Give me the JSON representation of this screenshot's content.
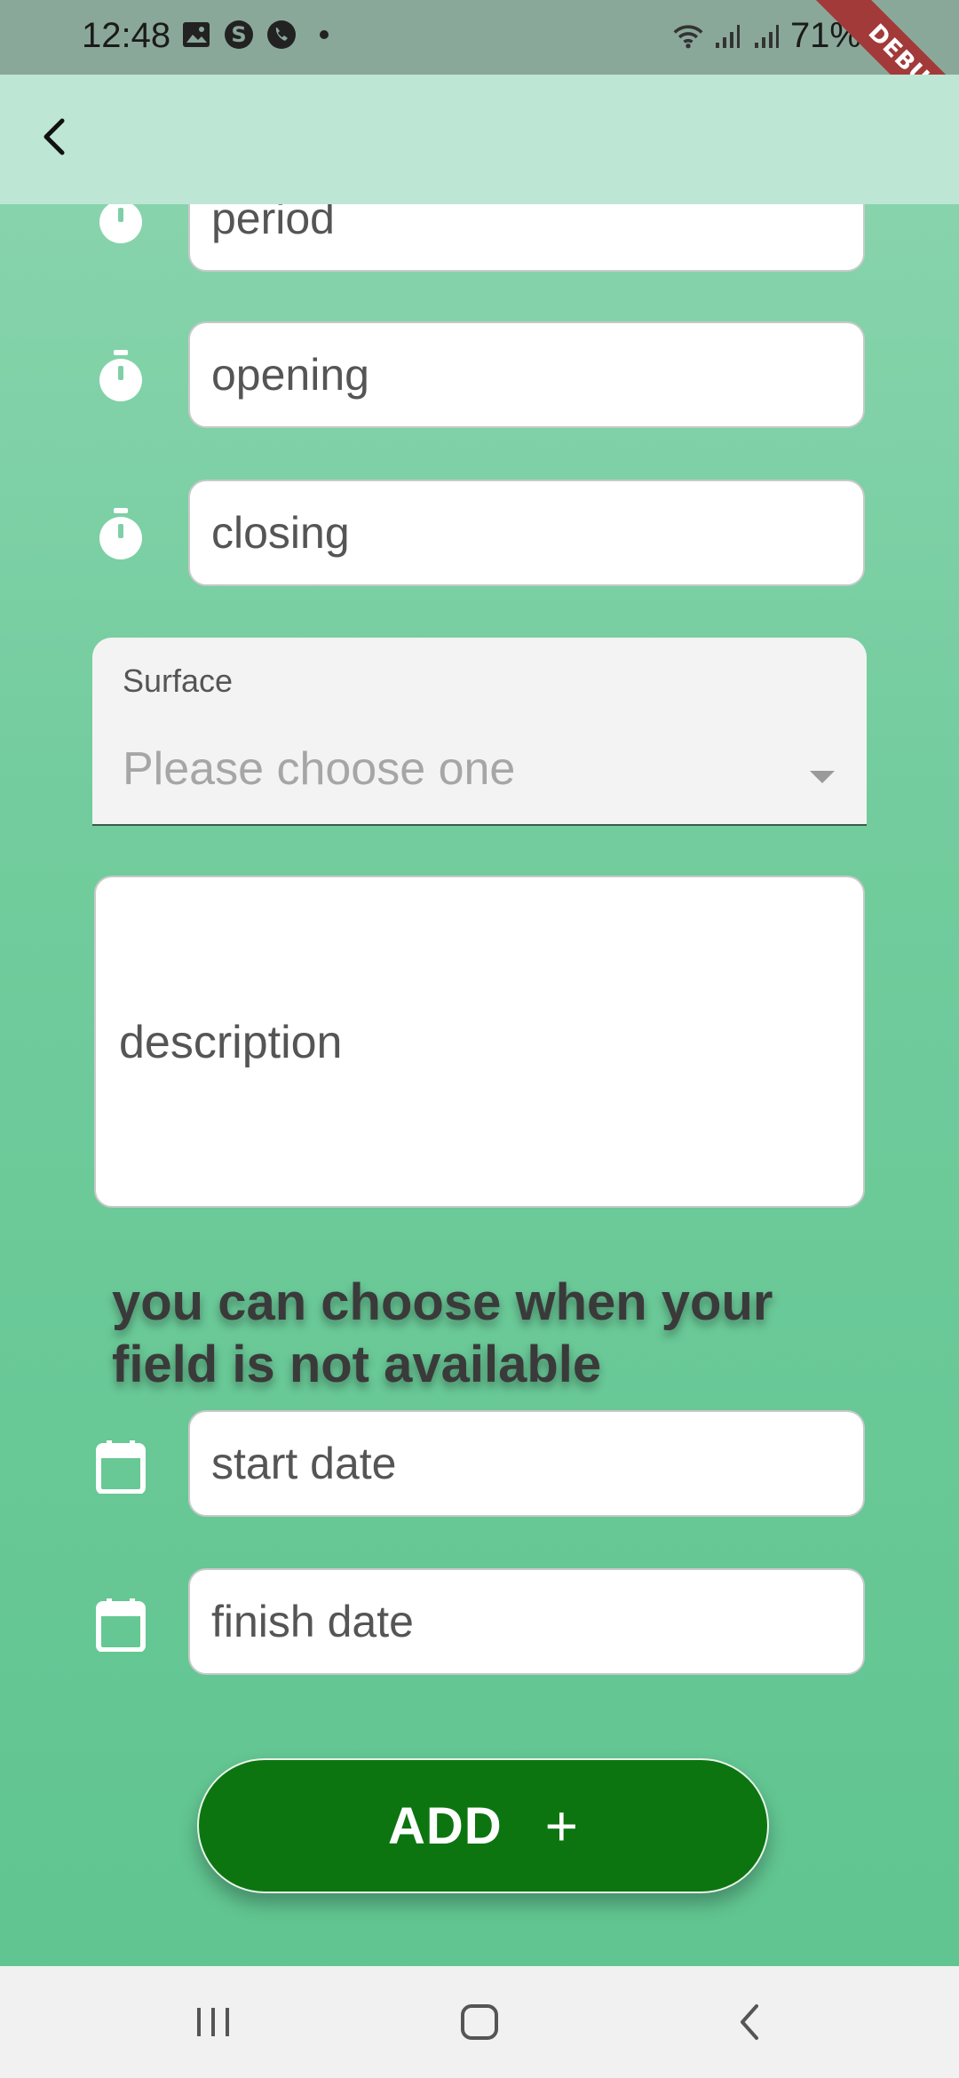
{
  "status_bar": {
    "time": "12:48",
    "battery_percent": "71%",
    "left_icons": [
      "image-icon",
      "s-badge-icon",
      "phone-icon",
      "dot-icon"
    ],
    "right_icons": [
      "wifi-icon",
      "signal-icon",
      "signal-icon",
      "battery-charging-icon"
    ]
  },
  "debug_ribbon": "DEBUG",
  "app_bar": {
    "back_icon": "chevron-left-icon"
  },
  "form": {
    "period_placeholder": "period",
    "opening_placeholder": "opening",
    "closing_placeholder": "closing",
    "surface": {
      "label": "Surface",
      "value_placeholder": "Please choose one"
    },
    "description_placeholder": "description",
    "notice": "you can choose when your field is not available",
    "start_date_placeholder": "start date",
    "finish_date_placeholder": "finish date",
    "add_button": {
      "label": "ADD",
      "icon": "+"
    }
  },
  "icons": {
    "timer": "timer-icon",
    "calendar": "calendar-icon"
  },
  "colors": {
    "background_top": "#8ed6b1",
    "background_bottom": "#5ec48f",
    "app_bar": "#bde6d4",
    "add_button": "#0c7510"
  },
  "nav_bar": {
    "items": [
      "recent-apps-icon",
      "home-icon",
      "back-icon"
    ]
  }
}
